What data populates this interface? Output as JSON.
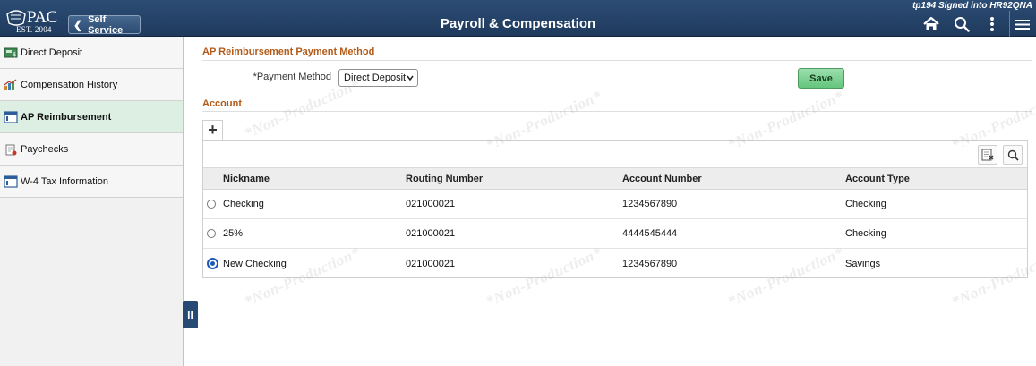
{
  "header": {
    "logo_text": "PAC",
    "logo_est": "EST. 2004",
    "signed_in": "tp194 Signed into HR92QNA",
    "back_label": "Self Service",
    "title": "Payroll & Compensation",
    "icons": [
      "home-icon",
      "search-icon",
      "more-vertical-icon",
      "hamburger-menu-icon"
    ]
  },
  "sidebar": {
    "items": [
      {
        "label": "Direct Deposit",
        "icon": "direct-deposit-icon",
        "active": false
      },
      {
        "label": "Compensation History",
        "icon": "compensation-chart-icon",
        "active": false
      },
      {
        "label": "AP Reimbursement",
        "icon": "reimbursement-icon",
        "active": true
      },
      {
        "label": "Paychecks",
        "icon": "paycheck-icon",
        "active": false
      },
      {
        "label": "W-4 Tax Information",
        "icon": "tax-form-icon",
        "active": false
      }
    ],
    "collapse_glyph": "II"
  },
  "payment": {
    "title": "AP Reimbursement Payment Method",
    "method_label": "*Payment Method",
    "method_value": "Direct Deposit",
    "save_label": "Save"
  },
  "account": {
    "title": "Account",
    "add_glyph": "+",
    "columns": [
      "Nickname",
      "Routing Number",
      "Account Number",
      "Account Type"
    ],
    "rows": [
      {
        "nickname": "Checking",
        "routing": "021000021",
        "account": "1234567890",
        "type": "Checking",
        "selected": false
      },
      {
        "nickname": "25%",
        "routing": "021000021",
        "account": "4444545444",
        "type": "Checking",
        "selected": false
      },
      {
        "nickname": "New Checking",
        "routing": "021000021",
        "account": "1234567890",
        "type": "Savings",
        "selected": true
      }
    ]
  },
  "watermark": "*Non-Production*",
  "colors": {
    "header_bg": "#1f3a5d",
    "section_title": "#b25a19",
    "save_button": "#64c57c",
    "active_nav": "#dcefe2",
    "radio_selected": "#1d5ab8"
  }
}
